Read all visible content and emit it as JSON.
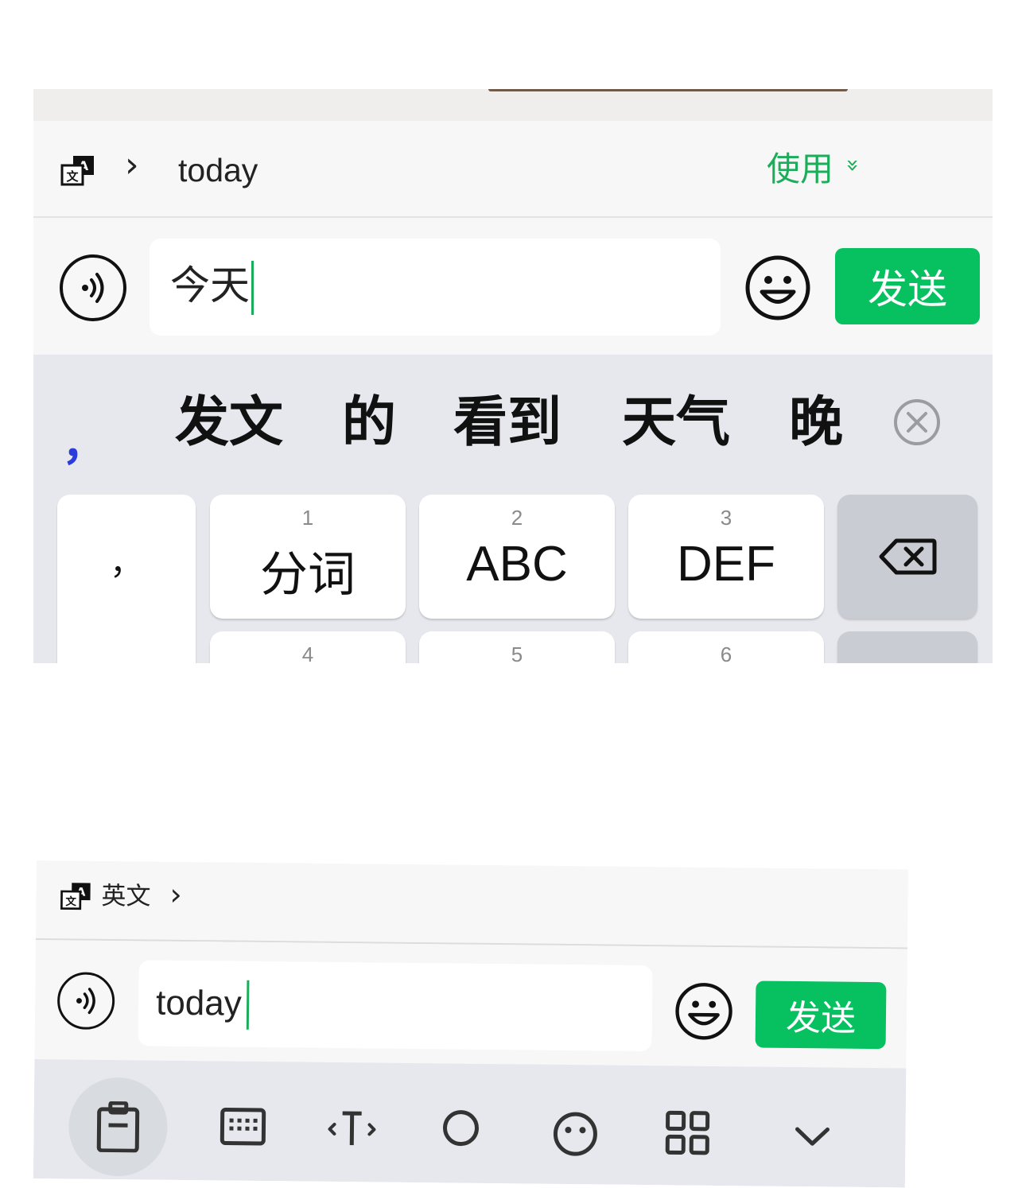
{
  "top": {
    "translation": {
      "arrow": "›",
      "result": "today",
      "use_label": "使用",
      "use_chevron": "»"
    },
    "input": {
      "text": "今天",
      "send_label": "发送"
    },
    "candidates": {
      "leading": "，",
      "items": [
        "发文",
        "的",
        "看到",
        "天气",
        "晚"
      ]
    },
    "keyboard": {
      "punct_keys": [
        "，",
        "。"
      ],
      "row1": [
        {
          "num": "1",
          "label": "分词"
        },
        {
          "num": "2",
          "label": "ABC"
        },
        {
          "num": "3",
          "label": "DEF"
        }
      ],
      "row2_nums": [
        "4",
        "5",
        "6"
      ]
    }
  },
  "bottom": {
    "language_label": "英文",
    "arrow": "›",
    "input": {
      "text": "today",
      "send_label": "发送"
    },
    "toolbar_icons": [
      "clipboard-icon",
      "keyboard-icon",
      "text-cursor-icon",
      "search-icon",
      "emoji-icon",
      "apps-icon",
      "collapse-icon"
    ]
  },
  "colors": {
    "accent_green": "#07c160",
    "use_green": "#1aad5a",
    "comma_blue": "#2b3bdc",
    "keyboard_bg": "#e6e8ed"
  }
}
